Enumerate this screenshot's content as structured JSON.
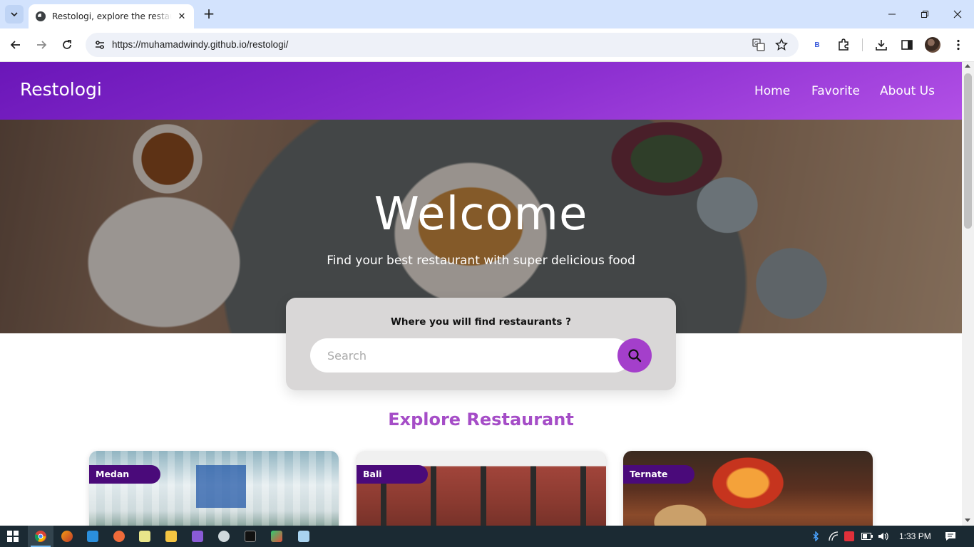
{
  "browser": {
    "tab_title": "Restologi, explore the restaurants",
    "url": "https://muhamadwindy.github.io/restologi/",
    "extension_label": "B"
  },
  "site": {
    "brand": "Restologi",
    "nav": [
      "Home",
      "Favorite",
      "About Us"
    ],
    "hero_title": "Welcome",
    "hero_subtitle": "Find your best restaurant with super delicious food",
    "search_label": "Where you will find restaurants ?",
    "search_placeholder": "Search",
    "section_title": "Explore Restaurant",
    "cards": [
      {
        "city": "Medan"
      },
      {
        "city": "Bali"
      },
      {
        "city": "Ternate"
      }
    ]
  },
  "taskbar": {
    "time": "1:33 PM"
  },
  "colors": {
    "header_gradient_start": "#6a16b8",
    "header_gradient_end": "#b250e6",
    "search_button": "#a43fcb",
    "section_title": "#a54dc7",
    "badge": "#4a0a7a"
  }
}
